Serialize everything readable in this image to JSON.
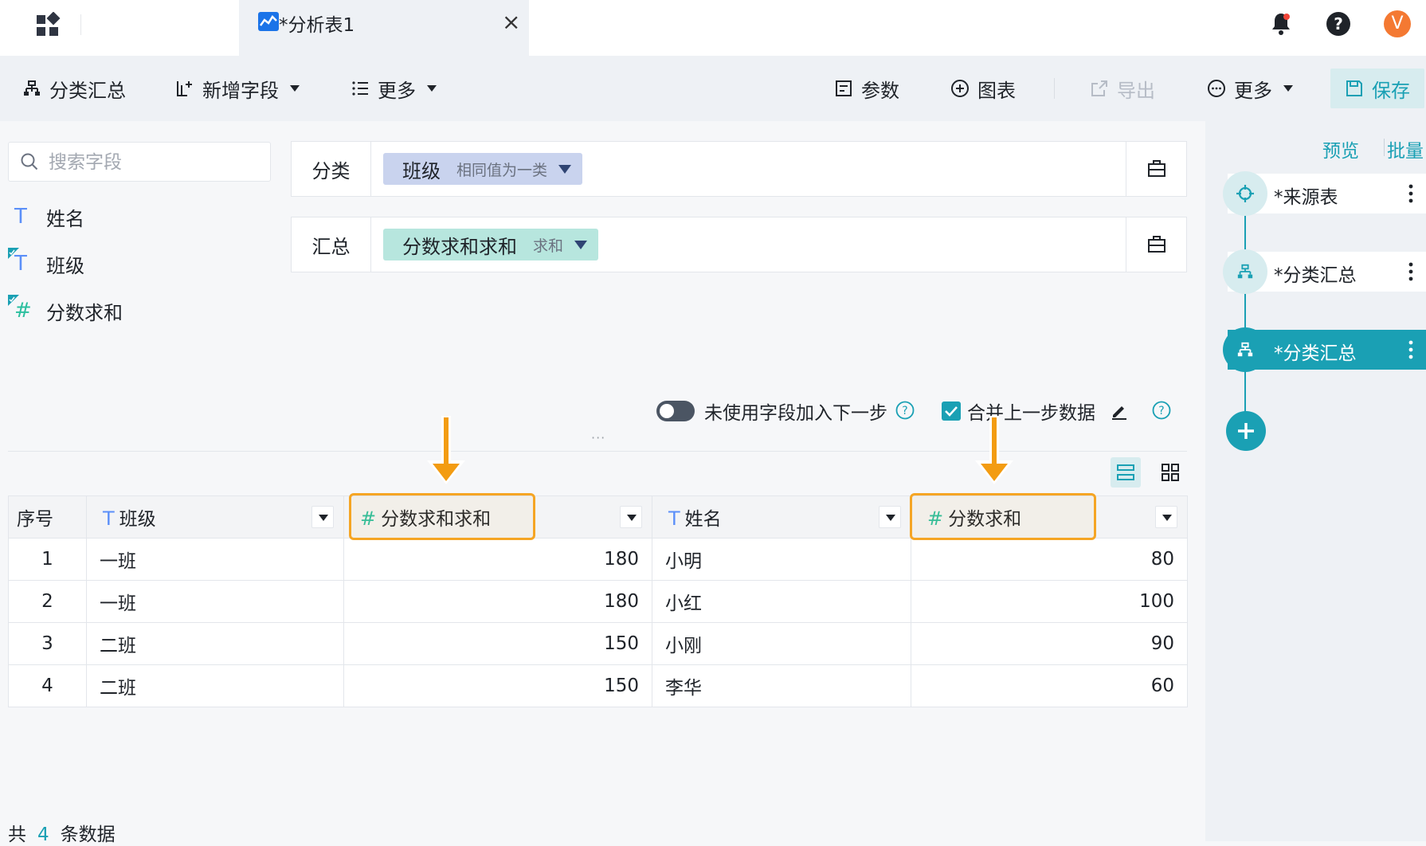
{
  "app": {
    "tab_title": "*分析表1",
    "avatar_initial": "V",
    "accent_color": "#1aa0b4"
  },
  "toolbar": {
    "group_summary": "分类汇总",
    "add_field": "新增字段",
    "more_left": "更多",
    "params": "参数",
    "chart": "图表",
    "export": "导出",
    "more_right": "更多",
    "save": "保存"
  },
  "fields_panel": {
    "search_placeholder": "搜索字段",
    "fields": [
      {
        "type_icon": "T",
        "name": "姓名"
      },
      {
        "type_icon": "T",
        "name": "班级"
      },
      {
        "type_icon": "#",
        "name": "分数求和"
      }
    ]
  },
  "config": {
    "group": {
      "label": "分类",
      "chip_name": "班级",
      "chip_sub": "相同值为一类"
    },
    "summary": {
      "label": "汇总",
      "chip_name": "分数求和求和",
      "chip_sub": "求和"
    }
  },
  "options": {
    "unused_fields_label": "未使用字段加入下一步",
    "merge_label": "合并上一步数据"
  },
  "table": {
    "columns": [
      {
        "type_icon": "",
        "name": "序号"
      },
      {
        "type_icon": "T",
        "name": "班级"
      },
      {
        "type_icon": "#",
        "name": "分数求和求和"
      },
      {
        "type_icon": "T",
        "name": "姓名"
      },
      {
        "type_icon": "#",
        "name": "分数求和"
      }
    ],
    "rows": [
      [
        "1",
        "一班",
        "180",
        "小明",
        "80"
      ],
      [
        "2",
        "一班",
        "180",
        "小红",
        "100"
      ],
      [
        "3",
        "二班",
        "150",
        "小刚",
        "90"
      ],
      [
        "4",
        "二班",
        "150",
        "李华",
        "60"
      ]
    ]
  },
  "footer": {
    "prefix": "共",
    "count": "4",
    "suffix": "条数据"
  },
  "flow_panel": {
    "preview": "预览",
    "batch": "批量",
    "steps": [
      {
        "label": "*来源表",
        "icon": "source-icon"
      },
      {
        "label": "*分类汇总",
        "icon": "group-summary-icon"
      },
      {
        "label": "*分类汇总",
        "icon": "group-summary-icon"
      }
    ]
  }
}
